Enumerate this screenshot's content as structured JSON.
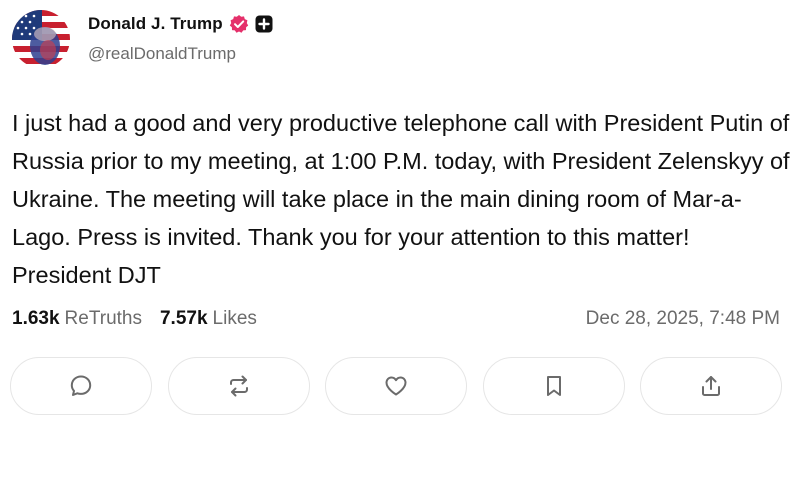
{
  "author": {
    "display_name": "Donald J. Trump",
    "handle": "@realDonaldTrump",
    "avatar_icon": "avatar-flag-portrait",
    "verified_icon": "verified-badge-icon",
    "verified_color": "#e5306b",
    "extra_badge_icon": "plus-square-icon"
  },
  "post": {
    "text": "I just had a good and very productive telephone call with President Putin of Russia prior to my meeting, at 1:00 P.M. today, with President Zelenskyy of Ukraine. The meeting will take place in the main dining room of Mar-a-Lago. Press is invited. Thank you for your attention to this matter! President DJT",
    "retruths_count": "1.63k",
    "retruths_label": "ReTruths",
    "likes_count": "7.57k",
    "likes_label": "Likes",
    "timestamp": "Dec 28, 2025, 7:48 PM"
  },
  "actions": [
    {
      "name": "reply",
      "icon": "comment-bubble-icon"
    },
    {
      "name": "retruth",
      "icon": "repost-arrows-icon"
    },
    {
      "name": "like",
      "icon": "heart-icon"
    },
    {
      "name": "bookmark",
      "icon": "bookmark-icon"
    },
    {
      "name": "share",
      "icon": "share-upload-icon"
    }
  ],
  "colors": {
    "text_primary": "#111111",
    "text_secondary": "#6b6b6b",
    "button_border": "#e6e6e6",
    "icon_stroke": "#6b6b6b"
  }
}
